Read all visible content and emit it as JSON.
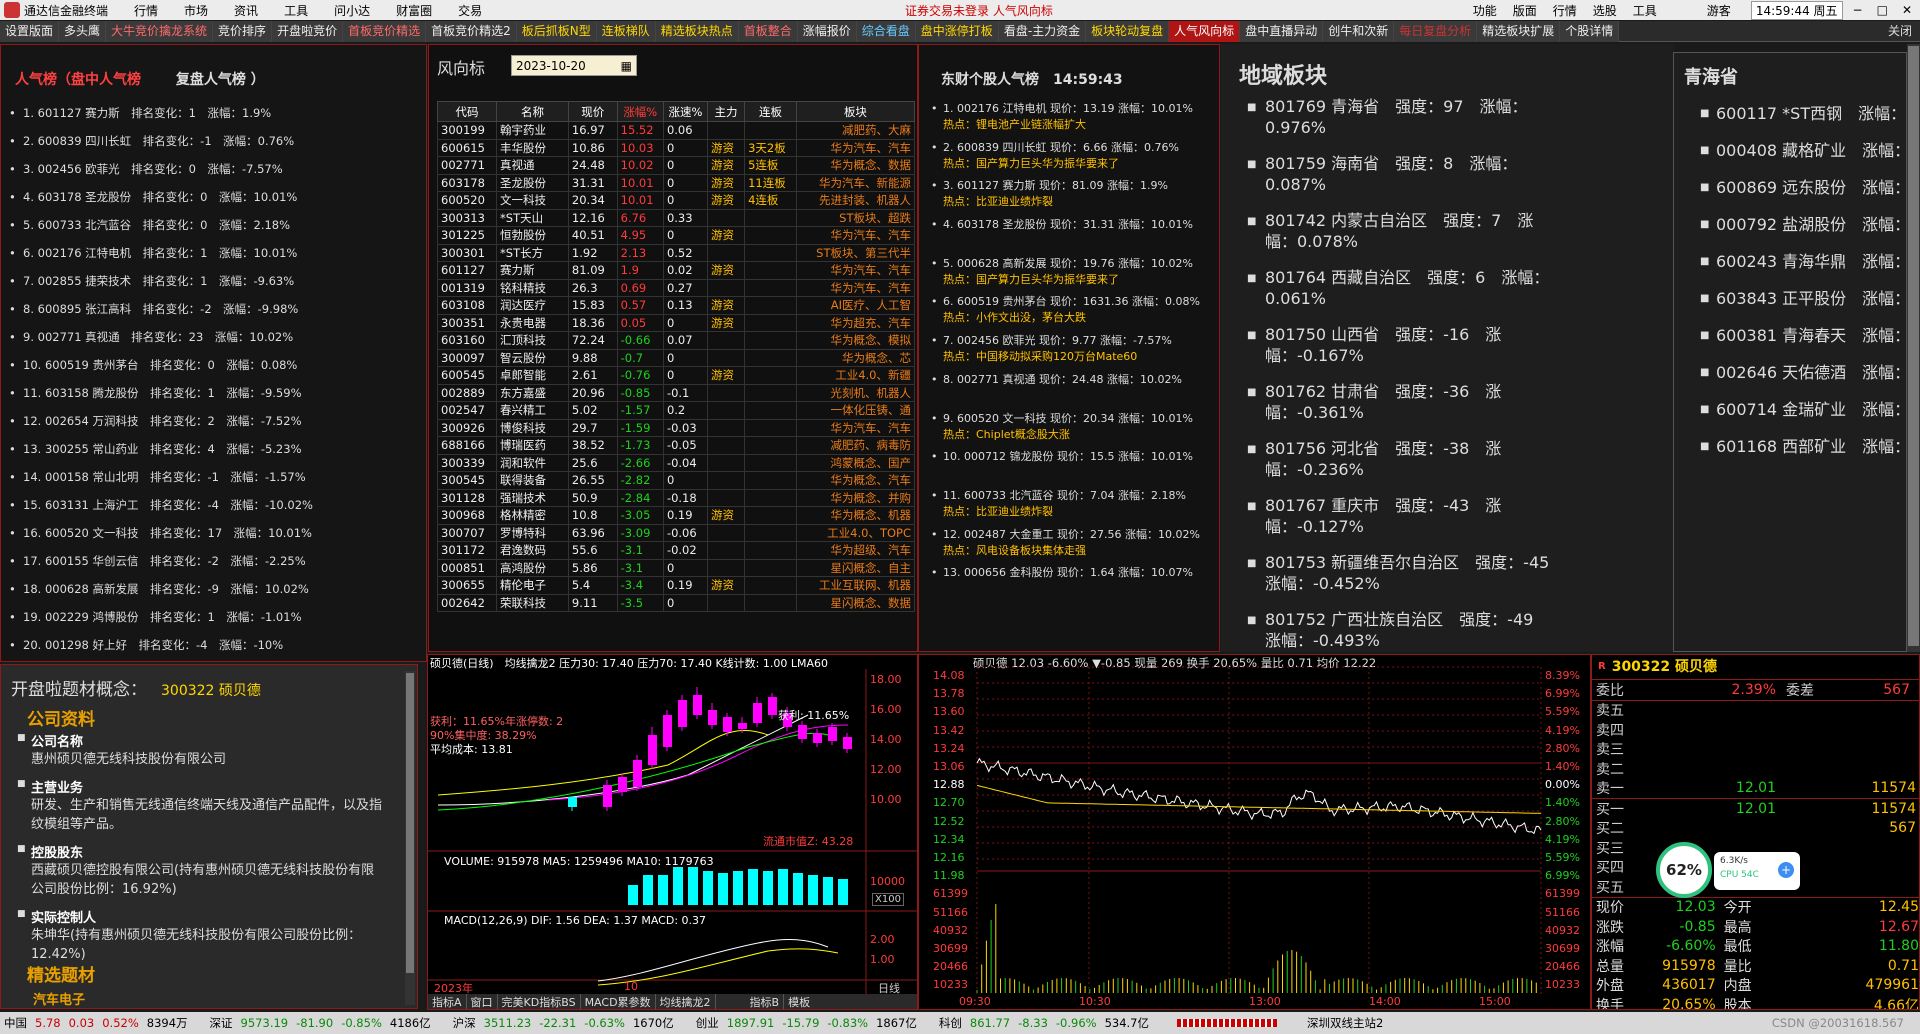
{
  "menubar": {
    "app": "通达信金融终端",
    "items": [
      "行情",
      "市场",
      "资讯",
      "工具",
      "问小达",
      "财富圈",
      "交易"
    ],
    "notice": "证券交易未登录 人气风向标",
    "right": [
      "功能",
      "版面",
      "行情",
      "选股",
      "工具",
      "游客"
    ],
    "time": "14:59:44 周五"
  },
  "tabs": [
    "设置版面",
    "多头鹰",
    "大牛竞价擒龙系统",
    "竞价排序",
    "开盘啦竞价",
    "首板竞价精选",
    "首板竞价精选2",
    "板后抓板N型",
    "连板梯队",
    "精选板块热点",
    "首板整合",
    "涨幅报价",
    "综合看盘",
    "盘中涨停打板",
    "看盘-主力资金",
    "板块轮动复盘",
    "人气风向标",
    "盘中直播异动",
    "创牛和次新",
    "每日复盘分析",
    "精选板块扩展",
    "个股详情"
  ],
  "tabs_close": "关闭",
  "popularity": {
    "title": "人气榜（盘中人气榜",
    "title2": "复盘人气榜 ）",
    "items": [
      "1. 601127 赛力斯　排名变化：1　涨幅：1.9%",
      "2. 600839 四川长虹　排名变化：-1　涨幅：0.76%",
      "3. 002456 欧菲光　排名变化：0　涨幅：-7.57%",
      "4. 603178 圣龙股份　排名变化：0　涨幅：10.01%",
      "5. 600733 北汽蓝谷　排名变化：0　涨幅：2.18%",
      "6. 002176 江特电机　排名变化：1　涨幅：10.01%",
      "7. 002855 捷荣技术　排名变化：1　涨幅：-9.63%",
      "8. 600895 张江高科　排名变化：-2　涨幅：-9.98%",
      "9. 002771 真视通　排名变化：23　涨幅：10.02%",
      "10. 600519 贵州茅台　排名变化：0　涨幅：0.08%",
      "11. 603158 腾龙股份　排名变化：1　涨幅：-9.59%",
      "12. 002654 万润科技　排名变化：2　涨幅：-7.52%",
      "13. 300255 常山药业　排名变化：4　涨幅：-5.23%",
      "14. 000158 常山北明　排名变化：-1　涨幅：-1.57%",
      "15. 603131 上海沪工　排名变化：-4　涨幅：-10.02%",
      "16. 600520 文一科技　排名变化：17　涨幅：10.01%",
      "17. 600155 华创云信　排名变化：-2　涨幅：-2.25%",
      "18. 000628 高新发展　排名变化：-9　涨幅：10.02%",
      "19. 002229 鸿博股份　排名变化：1　涨幅：-1.01%",
      "20. 001298 好上好　排名变化：-4　涨幅：-10%"
    ]
  },
  "wind": {
    "title": "风向标",
    "date": "2023-10-20",
    "headers": [
      "代码",
      "名称",
      "现价",
      "涨幅%",
      "涨速%",
      "主力",
      "连板",
      "板块"
    ],
    "rows": [
      [
        "300199",
        "翰宇药业",
        "16.97",
        "15.52",
        "0.06",
        "",
        "",
        "减肥药、大麻"
      ],
      [
        "600615",
        "丰华股份",
        "10.86",
        "10.03",
        "0",
        "游资",
        "3天2板",
        "华为汽车、汽车"
      ],
      [
        "002771",
        "真视通",
        "24.48",
        "10.02",
        "0",
        "游资",
        "5连板",
        "华为概念、数据"
      ],
      [
        "603178",
        "圣龙股份",
        "31.31",
        "10.01",
        "0",
        "游资",
        "11连板",
        "华为汽车、新能源"
      ],
      [
        "600520",
        "文一科技",
        "20.34",
        "10.01",
        "0",
        "游资",
        "4连板",
        "先进封装、机器人"
      ],
      [
        "300313",
        "*ST天山",
        "12.16",
        "6.76",
        "0.33",
        "",
        "",
        "ST板块、超跌"
      ],
      [
        "301225",
        "恒勃股份",
        "40.51",
        "4.95",
        "0",
        "游资",
        "",
        "华为汽车、汽车"
      ],
      [
        "300301",
        "*ST长方",
        "1.92",
        "2.13",
        "0.52",
        "",
        "",
        "ST板块、第三代半"
      ],
      [
        "601127",
        "赛力斯",
        "81.09",
        "1.9",
        "0.02",
        "游资",
        "",
        "华为汽车、汽车"
      ],
      [
        "001319",
        "铭科精技",
        "26.3",
        "0.69",
        "0.27",
        "",
        "",
        "华为汽车、汽车"
      ],
      [
        "603108",
        "润达医疗",
        "15.83",
        "0.57",
        "0.13",
        "游资",
        "",
        "AI医疗、人工智"
      ],
      [
        "300351",
        "永贵电器",
        "18.36",
        "0.05",
        "0",
        "游资",
        "",
        "华为超充、汽车"
      ],
      [
        "603160",
        "汇顶科技",
        "72.24",
        "-0.66",
        "0.07",
        "",
        "",
        "华为概念、模拟"
      ],
      [
        "300097",
        "智云股份",
        "9.88",
        "-0.7",
        "0",
        "",
        "",
        "华为概念、芯"
      ],
      [
        "600545",
        "卓郎智能",
        "2.61",
        "-0.76",
        "0",
        "游资",
        "",
        "工业4.0、新疆"
      ],
      [
        "002889",
        "东方嘉盛",
        "20.96",
        "-0.85",
        "-0.1",
        "",
        "",
        "光刻机、机器人"
      ],
      [
        "002547",
        "春兴精工",
        "5.02",
        "-1.57",
        "0.2",
        "",
        "",
        "一体化压铸、通"
      ],
      [
        "300926",
        "博俊科技",
        "29.7",
        "-1.59",
        "-0.03",
        "",
        "",
        "华为汽车、汽车"
      ],
      [
        "688166",
        "博瑞医药",
        "38.52",
        "-1.73",
        "-0.05",
        "",
        "",
        "减肥药、病毒防"
      ],
      [
        "300339",
        "润和软件",
        "25.6",
        "-2.66",
        "-0.04",
        "",
        "",
        "鸿蒙概念、国产"
      ],
      [
        "300545",
        "联得装备",
        "26.55",
        "-2.82",
        "0",
        "",
        "",
        "华为概念、汽车"
      ],
      [
        "301128",
        "强瑞技术",
        "50.9",
        "-2.84",
        "-0.18",
        "",
        "",
        "华为概念、并购"
      ],
      [
        "300968",
        "格林精密",
        "10.8",
        "-3.05",
        "0.19",
        "游资",
        "",
        "华为概念、机器"
      ],
      [
        "300707",
        "罗博特科",
        "63.96",
        "-3.09",
        "-0.06",
        "",
        "",
        "工业4.0、TOPC"
      ],
      [
        "301172",
        "君逸数码",
        "55.6",
        "-3.1",
        "-0.02",
        "",
        "",
        "华为超级、汽车"
      ],
      [
        "000851",
        "高鸿股份",
        "5.86",
        "-3.1",
        "0",
        "",
        "",
        "星闪概念、自主"
      ],
      [
        "300655",
        "精伦电子",
        "5.4",
        "-3.4",
        "0.19",
        "游资",
        "",
        "工业互联网、机器"
      ],
      [
        "002642",
        "荣联科技",
        "9.11",
        "-3.5",
        "0",
        "",
        "",
        "星闪概念、数据"
      ]
    ]
  },
  "eastmoney": {
    "title": "东财个股人气榜　14:59:43",
    "items": [
      {
        "line": "1. 002176 江特电机 现价：13.19 涨幅：10.01%",
        "hot": "热点：锂电池产业链涨幅扩大"
      },
      {
        "line": "2. 600839 四川长虹 现价：6.66 涨幅：0.76%",
        "hot": "热点：国产算力巨头华为振华要来了"
      },
      {
        "line": "3. 601127 赛力斯 现价：81.09 涨幅：1.9%",
        "hot": "热点：比亚迪业绩炸裂"
      },
      {
        "line": "4. 603178 圣龙股份 现价：31.31 涨幅：10.01%",
        "hot": ""
      },
      {
        "line": "5. 000628 高新发展 现价：19.76 涨幅：10.02%",
        "hot": "热点：国产算力巨头华为振华要来了"
      },
      {
        "line": "6. 600519 贵州茅台 现价：1631.36 涨幅：0.08%",
        "hot": "热点：小作文出没，茅台大跌"
      },
      {
        "line": "7. 002456 欧菲光 现价：9.77 涨幅：-7.57%",
        "hot": "热点：中国移动拟采购120万台Mate60"
      },
      {
        "line": "8. 002771 真视通 现价：24.48 涨幅：10.02%",
        "hot": ""
      },
      {
        "line": "9. 600520 文一科技 现价：20.34 涨幅：10.01%",
        "hot": "热点：Chiplet概念股大涨"
      },
      {
        "line": "10. 000712 锦龙股份 现价：15.5 涨幅：10.01%",
        "hot": ""
      },
      {
        "line": "11. 600733 北汽蓝谷 现价：7.04 涨幅：2.18%",
        "hot": "热点：比亚迪业绩炸裂"
      },
      {
        "line": "12. 002487 大金重工 现价：27.56 涨幅：10.02%",
        "hot": "热点：风电设备板块集体走强"
      },
      {
        "line": "13. 000656 金科股份 现价：1.64 涨幅：10.07%",
        "hot": ""
      }
    ]
  },
  "region": {
    "title": "地域板块",
    "items": [
      "801769 青海省　强度：97　涨幅：0.976%",
      "801759 海南省　强度：8　涨幅：0.087%",
      "801742 内蒙古自治区　强度：7　涨幅：0.078%",
      "801764 西藏自治区　强度：6　涨幅：0.061%",
      "801750 山西省　强度：-16　涨幅：-0.167%",
      "801762 甘肃省　强度：-36　涨幅：-0.361%",
      "801756 河北省　强度：-38　涨幅：-0.236%",
      "801767 重庆市　强度：-43　涨幅：-0.127%",
      "801753 新疆维吾尔自治区　强度：-45　涨幅：-0.452%",
      "801752 广西壮族自治区　强度：-49　涨幅：-0.493%"
    ]
  },
  "province": {
    "title": "青海省",
    "items": [
      "600117 *ST西钢　涨幅：",
      "000408 藏格矿业　涨幅：",
      "600869 远东股份　涨幅：",
      "000792 盐湖股份　涨幅：",
      "600243 青海华鼎　涨幅：",
      "603843 正平股份　涨幅：",
      "600381 青海春天　涨幅：",
      "002646 天佑德酒　涨幅：",
      "600714 金瑞矿业　涨幅：",
      "601168 西部矿业　涨幅："
    ]
  },
  "concept": {
    "title": "开盘啦题材概念：",
    "code": "300322 硕贝德",
    "sec1": "公司资料",
    "items": [
      {
        "k": "公司名称",
        "v": "惠州硕贝德无线科技股份有限公司"
      },
      {
        "k": "主营业务",
        "v": "研发、生产和销售无线通信终端天线及通信产品配件，以及指纹模组等产品。"
      },
      {
        "k": "控股股东",
        "v": "西藏硕贝德控股有限公司(持有惠州硕贝德无线科技股份有限公司股份比例：16.92%)"
      },
      {
        "k": "实际控制人",
        "v": "朱坤华(持有惠州硕贝德无线科技股份有限公司股份比例：12.42%)"
      }
    ],
    "sec2": "精选题材",
    "next": "汽车电子"
  },
  "kline": {
    "header": "硕贝德(日线)　均线擒龙2 压力30: 17.40 压力70: 17.40 K线计数: 1.00 LMA60",
    "prices": [
      "18.00",
      "16.00",
      "14.00",
      "12.00",
      "10.00"
    ],
    "labels": [
      "获利：11.65%年涨停数: 2",
      "90%集中度: 38.29%",
      "平均成本: 13.81",
      "获利: 11.65%",
      "流通市值Z: 43.28"
    ],
    "vol_header": "VOLUME: 915978 MA5: 1259496 MA10: 1179763",
    "vol_axis": [
      "10000",
      "X100"
    ],
    "macd_header": "MACD(12,26,9) DIF: 1.56 DEA: 1.37 MACD: 0.37",
    "macd_axis": [
      "2.00",
      "1.00"
    ],
    "years": [
      "2023年",
      "10",
      "日线"
    ],
    "tabs": [
      "指标A",
      "窗口",
      "完美KD指标BS",
      "MACD累参数",
      "均线擒龙2",
      "指标B",
      "模板"
    ]
  },
  "intraday": {
    "header": "硕贝德 12.03 -6.60% ▼-0.85 现量 269 换手 20.65% 量比 0.71 均价 12.22",
    "left": [
      "14.08",
      "13.78",
      "13.60",
      "13.42",
      "13.24",
      "13.06",
      "12.88",
      "12.70",
      "12.52",
      "12.34",
      "12.16",
      "11.98",
      "61399",
      "51166",
      "40932",
      "30699",
      "20466",
      "10233"
    ],
    "right": [
      "8.39%",
      "6.99%",
      "5.59%",
      "4.19%",
      "2.80%",
      "1.40%",
      "0.00%",
      "1.40%",
      "2.80%",
      "4.19%",
      "5.59%",
      "6.99%",
      "61399",
      "51166",
      "40932",
      "30699",
      "20466",
      "10233"
    ],
    "times": [
      "09:30",
      "10:30",
      "13:00",
      "14:00",
      "15:00"
    ]
  },
  "quote": {
    "title": "300322 硕贝德",
    "wb_l": "委比",
    "wb_v": "2.39%",
    "wc_l": "委差",
    "wc_v": "567",
    "sell": [
      "卖五",
      "卖四",
      "卖三",
      "卖二",
      "卖一"
    ],
    "sell1_p": "12.01",
    "sell1_v": "11574",
    "buy": [
      "买一",
      "买二",
      "买三",
      "买四",
      "买五"
    ],
    "buy1_p": "12.01",
    "buy1_v": "11574",
    "buy2_v": "567",
    "stats": [
      [
        "现价",
        "12.03",
        "今开",
        "12.45"
      ],
      [
        "涨跌",
        "-0.85",
        "最高",
        "12.67"
      ],
      [
        "涨幅",
        "-6.60%",
        "最低",
        "11.80"
      ],
      [
        "总量",
        "915978",
        "量比",
        "0.71"
      ],
      [
        "外盘",
        "436017",
        "内盘",
        "479961"
      ],
      [
        "换手",
        "20.65%",
        "股本",
        "4.66亿"
      ]
    ]
  },
  "cpu": {
    "pct": "62%",
    "speed": "6.3K/s",
    "temp": "CPU 54C"
  },
  "status": {
    "items": [
      [
        "中国",
        "5.78",
        "0.03",
        "0.52%",
        "8394万"
      ],
      [
        "深证",
        "9573.19",
        "-81.90",
        "-0.85%",
        "4186亿"
      ],
      [
        "沪深",
        "3511.23",
        "-22.31",
        "-0.63%",
        "1670亿"
      ],
      [
        "创业",
        "1897.91",
        "-15.79",
        "-0.83%",
        "1867亿"
      ],
      [
        "科创",
        "861.77",
        "-8.33",
        "-0.96%",
        "534.7亿"
      ]
    ],
    "server": "深圳双线主站2",
    "watermark": "CSDN @20031618.567"
  },
  "chart_data": {
    "type": "line",
    "x": [
      "09:30",
      "10:30",
      "13:00",
      "14:00",
      "15:00"
    ],
    "title": "硕贝德",
    "ylabel": "",
    "ylim": [
      11.68,
      14.08
    ],
    "series": [
      {
        "values": [
          12.88,
          12.52,
          12.24,
          12.34,
          12.03
        ]
      }
    ]
  }
}
